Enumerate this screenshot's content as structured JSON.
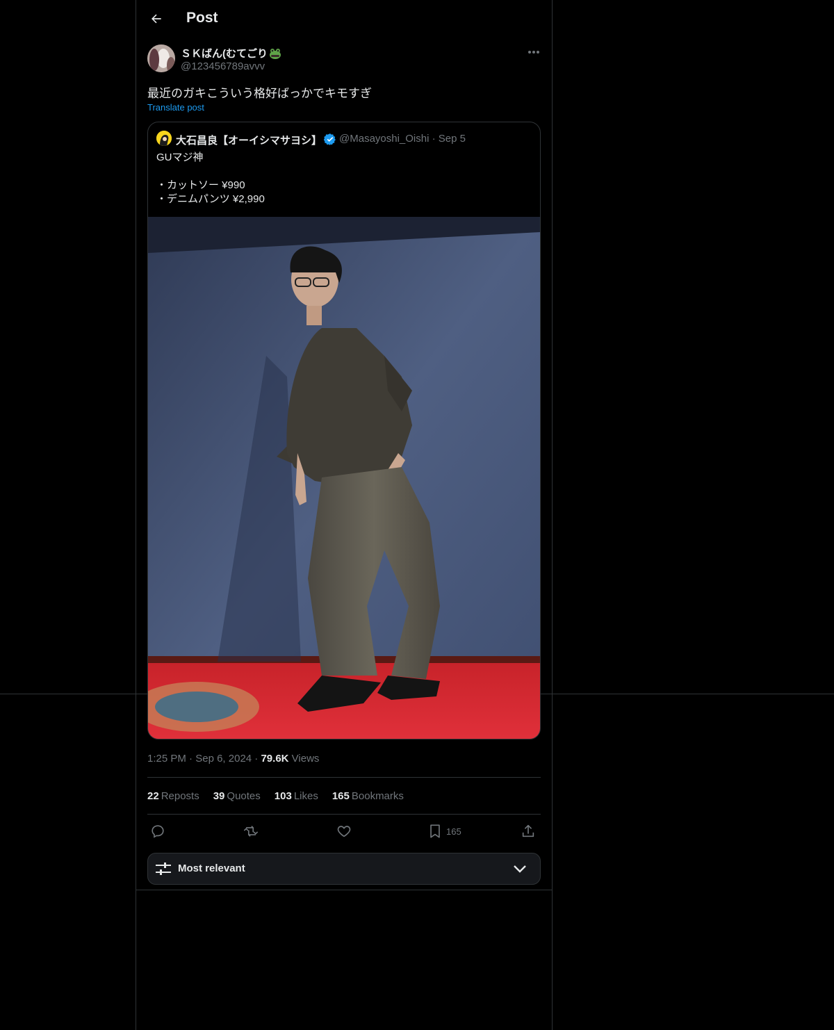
{
  "header": {
    "title": "Post"
  },
  "post": {
    "author_name": "ＳＫばん(むてごり",
    "author_handle": "@123456789avvv",
    "text": "最近のガキこういう格好ばっかでキモすぎ",
    "translate_label": "Translate post",
    "time": "1:25 PM",
    "date": "Sep 6, 2024",
    "views_count": "79.6K",
    "views_label": "Views"
  },
  "quote": {
    "author_name": "大石昌良【オーイシマサヨシ】",
    "author_handle": "@Masayoshi_Oishi",
    "date": "Sep 5",
    "lines": [
      "GUマジ神",
      "",
      "・カットソー ¥990",
      "・デニムパンツ ¥2,990"
    ]
  },
  "stats": {
    "reposts_count": "22",
    "reposts_label": "Reposts",
    "quotes_count": "39",
    "quotes_label": "Quotes",
    "likes_count": "103",
    "likes_label": "Likes",
    "bookmarks_count": "165",
    "bookmarks_label": "Bookmarks"
  },
  "actions": {
    "bookmark_count": "165"
  },
  "sort": {
    "label": "Most relevant"
  },
  "colors": {
    "background": "#000000",
    "accent": "#1d9bf0",
    "muted": "#71767b",
    "border": "#2f3336"
  }
}
